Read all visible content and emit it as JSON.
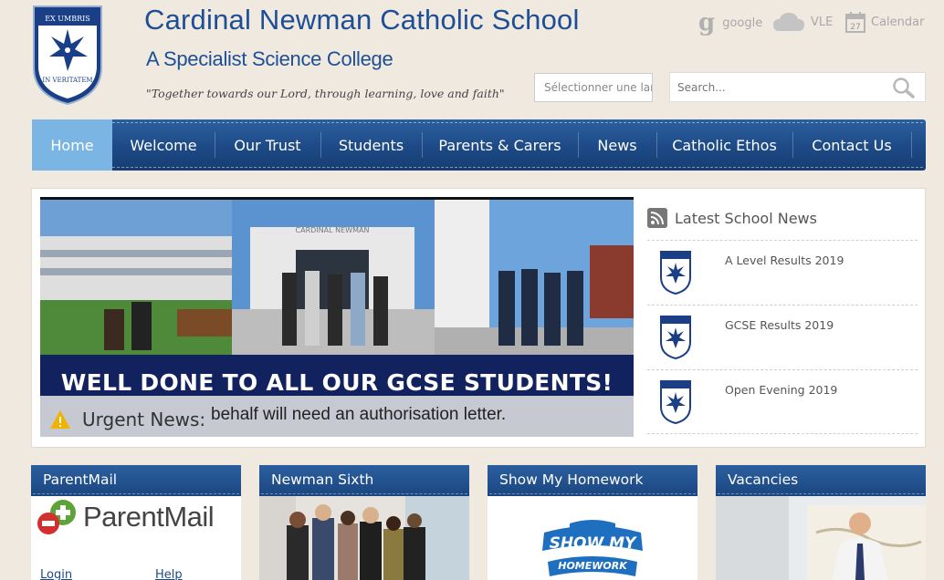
{
  "header": {
    "crest": {
      "top_text": "EX UMBRIS",
      "bottom_text": "IN VERITATEM"
    },
    "school_name": "Cardinal Newman Catholic School",
    "subtitle": "A Specialist Science College",
    "motto": "\"Together towards our Lord, through learning, love and faith\"",
    "tools": [
      {
        "label": "google",
        "icon": "google-icon"
      },
      {
        "label": "VLE",
        "icon": "cloud-icon"
      },
      {
        "label": "Calendar",
        "icon": "calendar-icon",
        "day": "27"
      }
    ],
    "language_select": {
      "value": "Sélectionner une langue"
    },
    "search": {
      "placeholder": "Search..."
    }
  },
  "nav": {
    "items": [
      {
        "label": "Home",
        "active": true
      },
      {
        "label": "Welcome"
      },
      {
        "label": "Our Trust"
      },
      {
        "label": "Students"
      },
      {
        "label": "Parents & Carers"
      },
      {
        "label": "News"
      },
      {
        "label": "Catholic Ethos"
      },
      {
        "label": "Contact Us"
      }
    ]
  },
  "slider": {
    "building_sign": "CARDINAL NEWMAN",
    "banner_text": "WELL DONE TO ALL OUR GCSE STUDENTS!",
    "urgent_label": "Urgent News:",
    "urgent_text": "behalf will need an authorisation letter."
  },
  "latest_news": {
    "title": "Latest School News",
    "items": [
      {
        "title": "A Level Results 2019"
      },
      {
        "title": "GCSE Results 2019"
      },
      {
        "title": "Open Evening 2019"
      }
    ]
  },
  "boxes": [
    {
      "title": "ParentMail",
      "logo_text": "ParentMail",
      "links": [
        "Login",
        "Help"
      ]
    },
    {
      "title": "Newman Sixth"
    },
    {
      "title": "Show My Homework",
      "logo_line1": "SHOW MY",
      "logo_line2": "HOMEWORK"
    },
    {
      "title": "Vacancies"
    }
  ],
  "colors": {
    "brand_blue": "#1e4f96",
    "nav_active": "#7ab5e4",
    "page_background": "#efe9e0"
  }
}
